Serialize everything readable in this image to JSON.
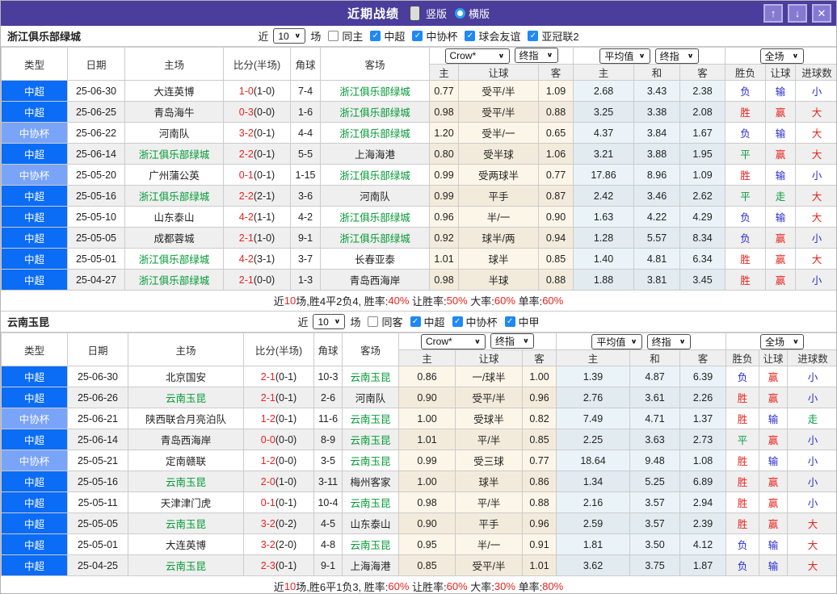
{
  "header": {
    "title": "近期战绩",
    "vertical_label": "竖版",
    "horizontal_label": "横版",
    "vertical_selected": true,
    "buttons": {
      "up": "↑",
      "down": "↓",
      "close": "✕"
    }
  },
  "colors": {
    "titlebar": "#4a3d9b",
    "titlebar_button": "#8579d1",
    "league_super": "#0b6cf5",
    "league_cup": "#7aa4f8",
    "team_highlight": "#009933",
    "score_red": "#e8231d",
    "result_red": "#e8231d",
    "result_blue": "#2a2ad0",
    "result_green": "#089b3c",
    "handicap_bg": "#fcf6e8",
    "average_bg": "#eaf4f8",
    "checkbox_blue": "#1f88f7"
  },
  "table_header": {
    "main": [
      "类型",
      "日期",
      "主场",
      "比分(半场)",
      "角球",
      "客场"
    ],
    "groups": [
      [
        "Crow*",
        "终指"
      ],
      [
        "平均值",
        "终指"
      ],
      [
        "全场"
      ]
    ],
    "sub": [
      "主",
      "让球",
      "客",
      "主",
      "和",
      "客",
      "胜负",
      "让球",
      "进球数"
    ]
  },
  "sections": [
    {
      "team": "浙江俱乐部绿城",
      "filter": {
        "near_label": "近",
        "count": "10",
        "games_label": "场",
        "same_label": "同主",
        "same_checked": false,
        "leagues": [
          {
            "label": "中超",
            "checked": true
          },
          {
            "label": "中协杯",
            "checked": true
          },
          {
            "label": "球会友谊",
            "checked": true
          },
          {
            "label": "亚冠联2",
            "checked": true
          }
        ]
      },
      "rows": [
        {
          "type": "中超",
          "date": "25-06-30",
          "home": "大连英博",
          "homeSelf": false,
          "score": "1-0",
          "half": "(1-0)",
          "corner": "7-4",
          "away": "浙江俱乐部绿城",
          "awaySelf": true,
          "odds": [
            "0.77",
            "受平/半",
            "1.09"
          ],
          "avg": [
            "2.68",
            "3.43",
            "2.38"
          ],
          "res": [
            "负:lose",
            "输:lose",
            "小:lose"
          ]
        },
        {
          "type": "中超",
          "date": "25-06-25",
          "home": "青岛海牛",
          "homeSelf": false,
          "score": "0-3",
          "half": "(0-0)",
          "corner": "1-6",
          "away": "浙江俱乐部绿城",
          "awaySelf": true,
          "odds": [
            "0.98",
            "受平/半",
            "0.88"
          ],
          "avg": [
            "3.25",
            "3.38",
            "2.08"
          ],
          "res": [
            "胜:win",
            "赢:win",
            "大:win"
          ]
        },
        {
          "type": "中协杯",
          "date": "25-06-22",
          "home": "河南队",
          "homeSelf": false,
          "score": "3-2",
          "half": "(0-1)",
          "corner": "4-4",
          "away": "浙江俱乐部绿城",
          "awaySelf": true,
          "odds": [
            "1.20",
            "受半/一",
            "0.65"
          ],
          "avg": [
            "4.37",
            "3.84",
            "1.67"
          ],
          "res": [
            "负:lose",
            "输:lose",
            "大:win"
          ]
        },
        {
          "type": "中超",
          "date": "25-06-14",
          "home": "浙江俱乐部绿城",
          "homeSelf": true,
          "score": "2-2",
          "half": "(0-1)",
          "corner": "5-5",
          "away": "上海海港",
          "awaySelf": false,
          "odds": [
            "0.80",
            "受半球",
            "1.06"
          ],
          "avg": [
            "3.21",
            "3.88",
            "1.95"
          ],
          "res": [
            "平:draw",
            "赢:win",
            "大:win"
          ]
        },
        {
          "type": "中协杯",
          "date": "25-05-20",
          "home": "广州蒲公英",
          "homeSelf": false,
          "score": "0-1",
          "half": "(0-1)",
          "corner": "1-15",
          "away": "浙江俱乐部绿城",
          "awaySelf": true,
          "odds": [
            "0.99",
            "受两球半",
            "0.77"
          ],
          "avg": [
            "17.86",
            "8.96",
            "1.09"
          ],
          "res": [
            "胜:win",
            "输:lose",
            "小:lose"
          ]
        },
        {
          "type": "中超",
          "date": "25-05-16",
          "home": "浙江俱乐部绿城",
          "homeSelf": true,
          "score": "2-2",
          "half": "(2-1)",
          "corner": "3-6",
          "away": "河南队",
          "awaySelf": false,
          "odds": [
            "0.99",
            "平手",
            "0.87"
          ],
          "avg": [
            "2.42",
            "3.46",
            "2.62"
          ],
          "res": [
            "平:draw",
            "走:draw",
            "大:win"
          ]
        },
        {
          "type": "中超",
          "date": "25-05-10",
          "home": "山东泰山",
          "homeSelf": false,
          "score": "4-2",
          "half": "(1-1)",
          "corner": "4-2",
          "away": "浙江俱乐部绿城",
          "awaySelf": true,
          "odds": [
            "0.96",
            "半/一",
            "0.90"
          ],
          "avg": [
            "1.63",
            "4.22",
            "4.29"
          ],
          "res": [
            "负:lose",
            "输:lose",
            "大:win"
          ]
        },
        {
          "type": "中超",
          "date": "25-05-05",
          "home": "成都蓉城",
          "homeSelf": false,
          "score": "2-1",
          "half": "(1-0)",
          "corner": "9-1",
          "away": "浙江俱乐部绿城",
          "awaySelf": true,
          "odds": [
            "0.92",
            "球半/两",
            "0.94"
          ],
          "avg": [
            "1.28",
            "5.57",
            "8.34"
          ],
          "res": [
            "负:lose",
            "赢:win",
            "小:lose"
          ]
        },
        {
          "type": "中超",
          "date": "25-05-01",
          "home": "浙江俱乐部绿城",
          "homeSelf": true,
          "score": "4-2",
          "half": "(3-1)",
          "corner": "3-7",
          "away": "长春亚泰",
          "awaySelf": false,
          "odds": [
            "1.01",
            "球半",
            "0.85"
          ],
          "avg": [
            "1.40",
            "4.81",
            "6.34"
          ],
          "res": [
            "胜:win",
            "赢:win",
            "大:win"
          ]
        },
        {
          "type": "中超",
          "date": "25-04-27",
          "home": "浙江俱乐部绿城",
          "homeSelf": true,
          "score": "2-1",
          "half": "(0-0)",
          "corner": "1-3",
          "away": "青岛西海岸",
          "awaySelf": false,
          "odds": [
            "0.98",
            "半球",
            "0.88"
          ],
          "avg": [
            "1.88",
            "3.81",
            "3.45"
          ],
          "res": [
            "胜:win",
            "赢:win",
            "小:lose"
          ]
        }
      ],
      "summary": [
        [
          "近",
          "k"
        ],
        [
          "10",
          "r"
        ],
        [
          "场,胜4平2负4, 胜率:",
          "k"
        ],
        [
          "40%",
          "r"
        ],
        [
          " 让胜率:",
          "k"
        ],
        [
          "50%",
          "r"
        ],
        [
          " 大率:",
          "k"
        ],
        [
          "60%",
          "r"
        ],
        [
          " 单率:",
          "k"
        ],
        [
          "60%",
          "r"
        ]
      ]
    },
    {
      "team": "云南玉昆",
      "filter": {
        "near_label": "近",
        "count": "10",
        "games_label": "场",
        "same_label": "同客",
        "same_checked": false,
        "leagues": [
          {
            "label": "中超",
            "checked": true
          },
          {
            "label": "中协杯",
            "checked": true
          },
          {
            "label": "中甲",
            "checked": true
          }
        ]
      },
      "rows": [
        {
          "type": "中超",
          "date": "25-06-30",
          "home": "北京国安",
          "homeSelf": false,
          "score": "2-1",
          "half": "(0-1)",
          "corner": "10-3",
          "away": "云南玉昆",
          "awaySelf": true,
          "odds": [
            "0.86",
            "一/球半",
            "1.00"
          ],
          "avg": [
            "1.39",
            "4.87",
            "6.39"
          ],
          "res": [
            "负:lose",
            "赢:win",
            "小:lose"
          ]
        },
        {
          "type": "中超",
          "date": "25-06-26",
          "home": "云南玉昆",
          "homeSelf": true,
          "score": "2-1",
          "half": "(0-1)",
          "corner": "2-6",
          "away": "河南队",
          "awaySelf": false,
          "odds": [
            "0.90",
            "受平/半",
            "0.96"
          ],
          "avg": [
            "2.76",
            "3.61",
            "2.26"
          ],
          "res": [
            "胜:win",
            "赢:win",
            "小:lose"
          ]
        },
        {
          "type": "中协杯",
          "date": "25-06-21",
          "home": "陕西联合月亮泊队",
          "homeSelf": false,
          "score": "1-2",
          "half": "(0-1)",
          "corner": "11-6",
          "away": "云南玉昆",
          "awaySelf": true,
          "odds": [
            "1.00",
            "受球半",
            "0.82"
          ],
          "avg": [
            "7.49",
            "4.71",
            "1.37"
          ],
          "res": [
            "胜:win",
            "输:lose",
            "走:draw"
          ]
        },
        {
          "type": "中超",
          "date": "25-06-14",
          "home": "青岛西海岸",
          "homeSelf": false,
          "score": "0-0",
          "half": "(0-0)",
          "corner": "8-9",
          "away": "云南玉昆",
          "awaySelf": true,
          "odds": [
            "1.01",
            "平/半",
            "0.85"
          ],
          "avg": [
            "2.25",
            "3.63",
            "2.73"
          ],
          "res": [
            "平:draw",
            "赢:win",
            "小:lose"
          ]
        },
        {
          "type": "中协杯",
          "date": "25-05-21",
          "home": "定南赣联",
          "homeSelf": false,
          "score": "1-2",
          "half": "(0-0)",
          "corner": "3-5",
          "away": "云南玉昆",
          "awaySelf": true,
          "odds": [
            "0.99",
            "受三球",
            "0.77"
          ],
          "avg": [
            "18.64",
            "9.48",
            "1.08"
          ],
          "res": [
            "胜:win",
            "输:lose",
            "小:lose"
          ]
        },
        {
          "type": "中超",
          "date": "25-05-16",
          "home": "云南玉昆",
          "homeSelf": true,
          "score": "2-0",
          "half": "(1-0)",
          "corner": "3-11",
          "away": "梅州客家",
          "awaySelf": false,
          "odds": [
            "1.00",
            "球半",
            "0.86"
          ],
          "avg": [
            "1.34",
            "5.25",
            "6.89"
          ],
          "res": [
            "胜:win",
            "赢:win",
            "小:lose"
          ]
        },
        {
          "type": "中超",
          "date": "25-05-11",
          "home": "天津津门虎",
          "homeSelf": false,
          "score": "0-1",
          "half": "(0-1)",
          "corner": "10-4",
          "away": "云南玉昆",
          "awaySelf": true,
          "odds": [
            "0.98",
            "平/半",
            "0.88"
          ],
          "avg": [
            "2.16",
            "3.57",
            "2.94"
          ],
          "res": [
            "胜:win",
            "赢:win",
            "小:lose"
          ]
        },
        {
          "type": "中超",
          "date": "25-05-05",
          "home": "云南玉昆",
          "homeSelf": true,
          "score": "3-2",
          "half": "(0-2)",
          "corner": "4-5",
          "away": "山东泰山",
          "awaySelf": false,
          "odds": [
            "0.90",
            "平手",
            "0.96"
          ],
          "avg": [
            "2.59",
            "3.57",
            "2.39"
          ],
          "res": [
            "胜:win",
            "赢:win",
            "大:win"
          ]
        },
        {
          "type": "中超",
          "date": "25-05-01",
          "home": "大连英博",
          "homeSelf": false,
          "score": "3-2",
          "half": "(2-0)",
          "corner": "4-8",
          "away": "云南玉昆",
          "awaySelf": true,
          "odds": [
            "0.95",
            "半/一",
            "0.91"
          ],
          "avg": [
            "1.81",
            "3.50",
            "4.12"
          ],
          "res": [
            "负:lose",
            "输:lose",
            "大:win"
          ]
        },
        {
          "type": "中超",
          "date": "25-04-25",
          "home": "云南玉昆",
          "homeSelf": true,
          "score": "2-3",
          "half": "(0-1)",
          "corner": "9-1",
          "away": "上海海港",
          "awaySelf": false,
          "odds": [
            "0.85",
            "受平/半",
            "1.01"
          ],
          "avg": [
            "3.62",
            "3.75",
            "1.87"
          ],
          "res": [
            "负:lose",
            "输:lose",
            "大:win"
          ]
        }
      ],
      "summary": [
        [
          "近",
          "k"
        ],
        [
          "10",
          "r"
        ],
        [
          "场,胜6平1负3, 胜率:",
          "k"
        ],
        [
          "60%",
          "r"
        ],
        [
          " 让胜率:",
          "k"
        ],
        [
          "60%",
          "r"
        ],
        [
          " 大率:",
          "k"
        ],
        [
          "30%",
          "r"
        ],
        [
          " 单率:",
          "k"
        ],
        [
          "80%",
          "r"
        ]
      ]
    }
  ]
}
